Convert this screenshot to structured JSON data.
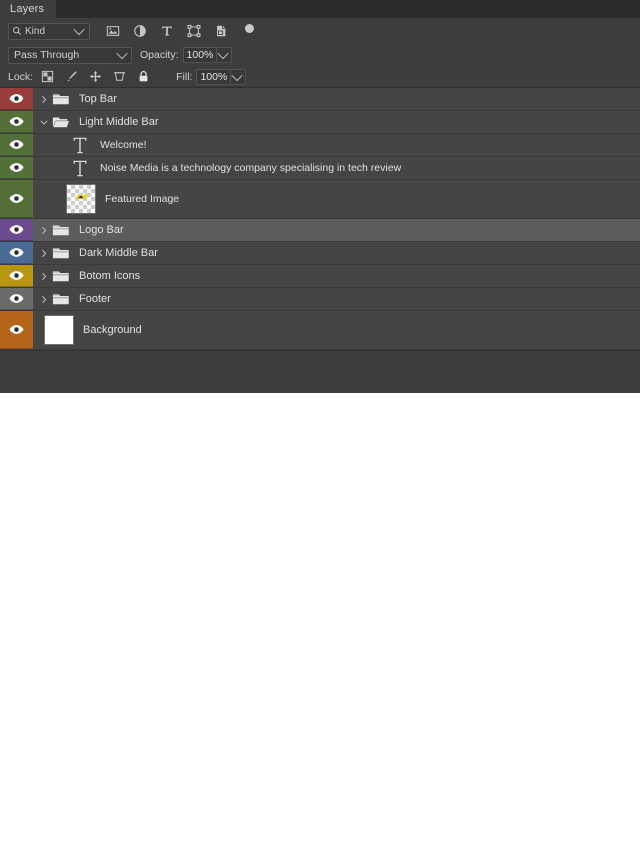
{
  "panel": {
    "tab_label": "Layers"
  },
  "filter_bar": {
    "kind_label": "Kind",
    "search_icon": "search-icon",
    "icons": [
      {
        "name": "filter-pixel-layers-icon",
        "title": "Pixel layers"
      },
      {
        "name": "filter-adjustment-layers-icon",
        "title": "Adjustment layers"
      },
      {
        "name": "filter-type-layers-icon",
        "title": "Type layers"
      },
      {
        "name": "filter-shape-layers-icon",
        "title": "Shape layers"
      },
      {
        "name": "filter-smart-object-layers-icon",
        "title": "Smart objects"
      }
    ],
    "toggle_name": "filter-enable-toggle"
  },
  "blend_bar": {
    "blend_mode": "Pass Through",
    "opacity_label": "Opacity:",
    "opacity_value": "100%"
  },
  "lock_bar": {
    "lock_label": "Lock:",
    "icons": [
      {
        "name": "lock-transparent-pixels-icon"
      },
      {
        "name": "lock-image-pixels-icon"
      },
      {
        "name": "lock-position-icon"
      },
      {
        "name": "lock-artboard-nesting-icon"
      },
      {
        "name": "lock-all-icon"
      }
    ],
    "fill_label": "Fill:",
    "fill_value": "100%"
  },
  "layers": [
    {
      "name": "Top Bar",
      "type": "group",
      "expanded": false,
      "visible": true,
      "selected": false,
      "color": "#9b3c3c",
      "indent": 0
    },
    {
      "name": "Light Middle Bar",
      "type": "group",
      "expanded": true,
      "visible": true,
      "selected": false,
      "color": "#547038",
      "indent": 0
    },
    {
      "name": "Welcome!",
      "type": "text",
      "visible": true,
      "selected": false,
      "color": "#547038",
      "indent": 1
    },
    {
      "name": "Noise Media is a technology company specialising in tech review",
      "type": "text",
      "visible": true,
      "selected": false,
      "color": "#547038",
      "indent": 1
    },
    {
      "name": "Featured Image",
      "type": "image",
      "visible": true,
      "selected": false,
      "color": "#547038",
      "indent": 1
    },
    {
      "name": "Logo Bar",
      "type": "group",
      "expanded": false,
      "visible": true,
      "selected": true,
      "color": "#6b4a90",
      "indent": 0
    },
    {
      "name": "Dark Middle Bar",
      "type": "group",
      "expanded": false,
      "visible": true,
      "selected": false,
      "color": "#4a6a96",
      "indent": 0
    },
    {
      "name": "Botom Icons",
      "type": "group",
      "expanded": false,
      "visible": true,
      "selected": false,
      "color": "#b8960d",
      "indent": 0
    },
    {
      "name": "Footer",
      "type": "group",
      "expanded": false,
      "visible": true,
      "selected": false,
      "color": "#6b6b6b",
      "indent": 0
    },
    {
      "name": "Background",
      "type": "background",
      "visible": true,
      "selected": false,
      "color": "#b5651a",
      "indent": 0
    }
  ],
  "theme": {
    "panel_bg": "#3d3d3d",
    "list_bg": "#454545",
    "selected_row_bg": "#5c5c5c",
    "text": "#e0e0e0",
    "tabbar_bg": "#2b2b2b"
  }
}
